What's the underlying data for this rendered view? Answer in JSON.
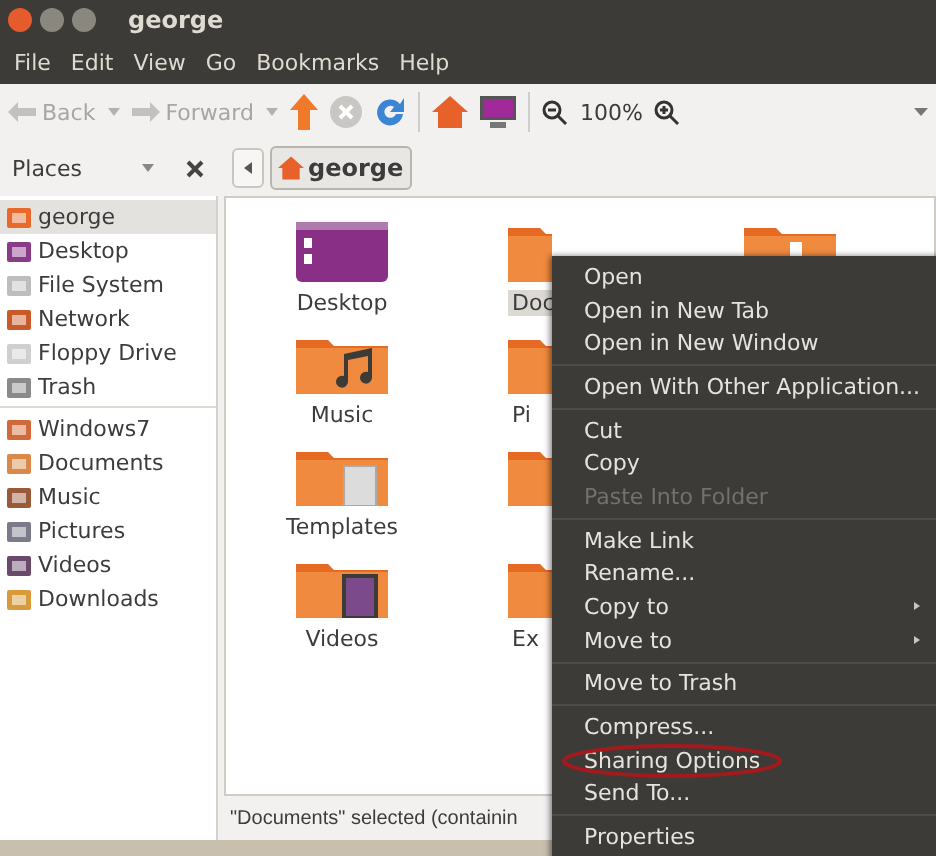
{
  "window": {
    "title": "george"
  },
  "menu_bar": [
    "File",
    "Edit",
    "View",
    "Go",
    "Bookmarks",
    "Help"
  ],
  "toolbar": {
    "back": {
      "label": "Back",
      "disabled": true
    },
    "forward": {
      "label": "Forward",
      "disabled": true
    },
    "zoom": "100%"
  },
  "places": {
    "label": "Places"
  },
  "path_bar": {
    "crumbs": [
      {
        "label": "george",
        "selected": true
      }
    ]
  },
  "sidebar": {
    "groups": [
      [
        {
          "label": "george",
          "selected": true
        },
        {
          "label": "Desktop",
          "selected": false
        },
        {
          "label": "File System",
          "selected": false
        },
        {
          "label": "Network",
          "selected": false
        },
        {
          "label": "Floppy Drive",
          "selected": false
        },
        {
          "label": "Trash",
          "selected": false
        }
      ],
      [
        {
          "label": "Windows7",
          "selected": false
        },
        {
          "label": "Documents",
          "selected": false
        },
        {
          "label": "Music",
          "selected": false
        },
        {
          "label": "Pictures",
          "selected": false
        },
        {
          "label": "Videos",
          "selected": false
        },
        {
          "label": "Downloads",
          "selected": false
        }
      ]
    ]
  },
  "files": [
    {
      "label": "Desktop",
      "kind": "full",
      "selected": false
    },
    {
      "label": "Doc",
      "kind": "partial",
      "selected": true
    },
    {
      "kind": "hidden"
    },
    {
      "label": "Music",
      "kind": "full",
      "selected": false
    },
    {
      "label": "Pi",
      "kind": "partial",
      "selected": false
    },
    {
      "kind": "gone"
    },
    {
      "label": "Templates",
      "kind": "full",
      "selected": false
    },
    {
      "kind": "iconless"
    },
    {
      "kind": "gone"
    },
    {
      "label": "Videos",
      "kind": "full",
      "selected": false
    },
    {
      "label": "Ex",
      "kind": "partial",
      "selected": false
    },
    {
      "kind": "gone"
    }
  ],
  "status_bar": "\"Documents\" selected (containin",
  "context_menu": [
    {
      "kind": "item",
      "label": "Open",
      "disabled": false,
      "submenu": false,
      "circled": false
    },
    {
      "kind": "item",
      "label": "Open in New Tab",
      "disabled": false,
      "submenu": false,
      "circled": false
    },
    {
      "kind": "item",
      "label": "Open in New Window",
      "disabled": false,
      "submenu": false,
      "circled": false
    },
    {
      "kind": "separator"
    },
    {
      "kind": "item",
      "label": "Open With Other Application...",
      "disabled": false,
      "submenu": false,
      "circled": false
    },
    {
      "kind": "separator"
    },
    {
      "kind": "item",
      "label": "Cut",
      "disabled": false,
      "submenu": false,
      "circled": false
    },
    {
      "kind": "item",
      "label": "Copy",
      "disabled": false,
      "submenu": false,
      "circled": false
    },
    {
      "kind": "item",
      "label": "Paste Into Folder",
      "disabled": true,
      "submenu": false,
      "circled": false
    },
    {
      "kind": "separator"
    },
    {
      "kind": "item",
      "label": "Make Link",
      "disabled": false,
      "submenu": false,
      "circled": false
    },
    {
      "kind": "item",
      "label": "Rename...",
      "disabled": false,
      "submenu": false,
      "circled": false
    },
    {
      "kind": "item",
      "label": "Copy to",
      "disabled": false,
      "submenu": true,
      "circled": false
    },
    {
      "kind": "item",
      "label": "Move to",
      "disabled": false,
      "submenu": true,
      "circled": false
    },
    {
      "kind": "separator"
    },
    {
      "kind": "item",
      "label": "Move to Trash",
      "disabled": false,
      "submenu": false,
      "circled": false
    },
    {
      "kind": "separator"
    },
    {
      "kind": "item",
      "label": "Compress...",
      "disabled": false,
      "submenu": false,
      "circled": false
    },
    {
      "kind": "item",
      "label": "Sharing Options",
      "disabled": false,
      "submenu": false,
      "circled": true
    },
    {
      "kind": "item",
      "label": "Send To...",
      "disabled": false,
      "submenu": false,
      "circled": false
    },
    {
      "kind": "separator"
    },
    {
      "kind": "item",
      "label": "Properties",
      "disabled": false,
      "submenu": false,
      "circled": false
    }
  ]
}
